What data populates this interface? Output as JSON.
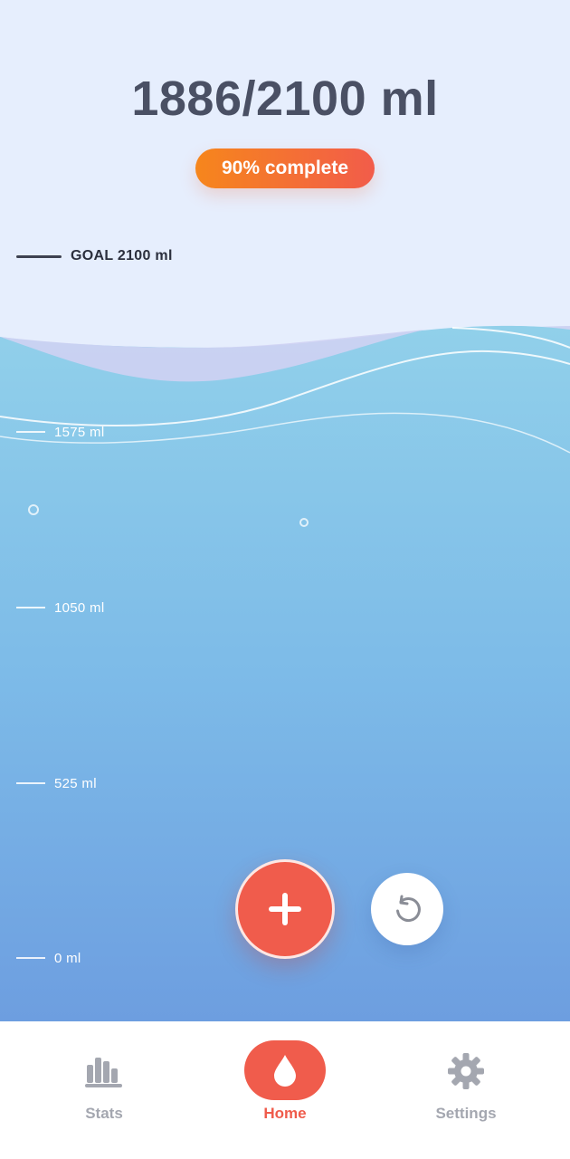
{
  "intake": {
    "counter_text": "1886/2100 ml",
    "consumed_ml": 1886,
    "goal_ml": 2100,
    "progress_fraction": 0.9
  },
  "badge": {
    "label": "90% complete"
  },
  "goal_marker": {
    "label": "GOAL 2100 ml"
  },
  "scale_marks": [
    {
      "label": "1575 ml",
      "value_ml": 1575
    },
    {
      "label": "1050 ml",
      "value_ml": 1050
    },
    {
      "label": "525 ml",
      "value_ml": 525
    },
    {
      "label": "0 ml",
      "value_ml": 0
    }
  ],
  "actions": {
    "add_icon": "plus-icon",
    "undo_icon": "undo-icon"
  },
  "tabbar": {
    "items": [
      {
        "id": "stats",
        "label": "Stats",
        "icon": "bar-chart-icon",
        "active": false
      },
      {
        "id": "home",
        "label": "Home",
        "icon": "water-drop-icon",
        "active": true
      },
      {
        "id": "settings",
        "label": "Settings",
        "icon": "gear-icon",
        "active": false
      }
    ]
  },
  "colors": {
    "background": "#e6eefd",
    "water_top": "#8fcfea",
    "water_bottom": "#6d9ee0",
    "accent": "#f05c4c",
    "badge_start": "#f6861c",
    "badge_end": "#f25c4a",
    "text_dark": "#4a5064",
    "tab_inactive": "#a4a7b0"
  }
}
